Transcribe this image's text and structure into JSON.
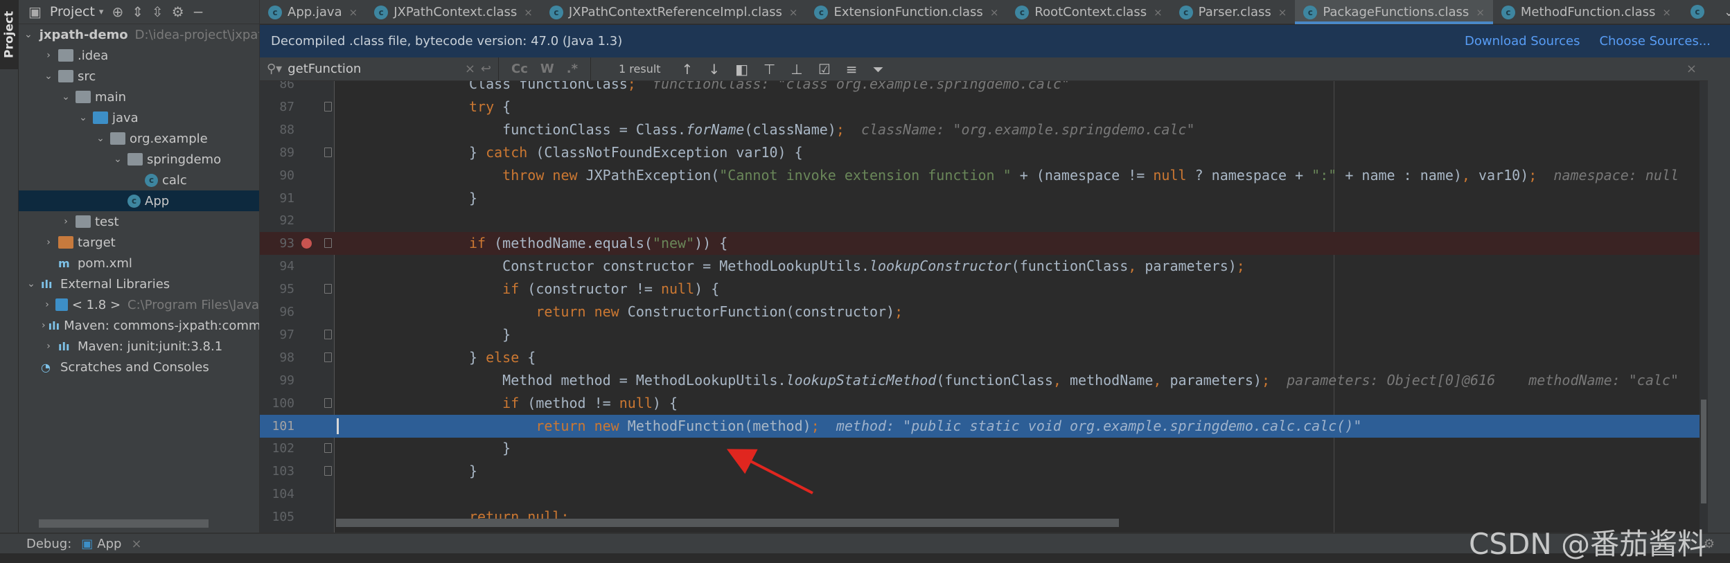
{
  "side_strip": {
    "label": "Project"
  },
  "project_panel": {
    "title": "Project",
    "tree": [
      {
        "label": "jxpath-demo",
        "path": "D:\\idea-project\\jxpath",
        "level": 0,
        "arrow": "down",
        "icon": "module-icon",
        "bold": true
      },
      {
        "label": ".idea",
        "level": 1,
        "arrow": "right",
        "icon": "folder-icon"
      },
      {
        "label": "src",
        "level": 1,
        "arrow": "down",
        "icon": "folder-icon"
      },
      {
        "label": "main",
        "level": 2,
        "arrow": "down",
        "icon": "folder-icon"
      },
      {
        "label": "java",
        "level": 3,
        "arrow": "down",
        "icon": "source-folder-icon"
      },
      {
        "label": "org.example",
        "level": 4,
        "arrow": "down",
        "icon": "package-icon"
      },
      {
        "label": "springdemo",
        "level": 5,
        "arrow": "down",
        "icon": "package-icon"
      },
      {
        "label": "calc",
        "level": 6,
        "arrow": "",
        "icon": "class-icon"
      },
      {
        "label": "App",
        "level": 5,
        "arrow": "",
        "icon": "class-icon",
        "selected": true
      },
      {
        "label": "test",
        "level": 2,
        "arrow": "right",
        "icon": "folder-icon"
      },
      {
        "label": "target",
        "level": 1,
        "arrow": "right",
        "icon": "excluded-folder-icon"
      },
      {
        "label": "pom.xml",
        "level": 1,
        "arrow": "",
        "icon": "maven-icon"
      },
      {
        "label": "External Libraries",
        "level": 0,
        "arrow": "down",
        "icon": "library-icon"
      },
      {
        "label": "< 1.8 >",
        "path": "C:\\Program Files\\Java",
        "level": 1,
        "arrow": "right",
        "icon": "jdk-icon"
      },
      {
        "label": "Maven: commons-jxpath:commons-jxpath",
        "level": 1,
        "arrow": "right",
        "icon": "library-icon"
      },
      {
        "label": "Maven: junit:junit:3.8.1",
        "level": 1,
        "arrow": "right",
        "icon": "library-icon"
      },
      {
        "label": "Scratches and Consoles",
        "level": 0,
        "arrow": "",
        "icon": "scratches-icon"
      }
    ]
  },
  "tabs": [
    {
      "label": "App.java"
    },
    {
      "label": "JXPathContext.class"
    },
    {
      "label": "JXPathContextReferenceImpl.class"
    },
    {
      "label": "ExtensionFunction.class"
    },
    {
      "label": "RootContext.class"
    },
    {
      "label": "Parser.class"
    },
    {
      "label": "PackageFunctions.class",
      "active": true
    },
    {
      "label": "MethodFunction.class"
    }
  ],
  "notification": {
    "text": "Decompiled .class file, bytecode version: 47.0 (Java 1.3)",
    "download_sources": "Download Sources",
    "choose_sources": "Choose Sources..."
  },
  "search": {
    "value": "getFunction",
    "case_label": "Cc",
    "words_label": "W",
    "regex_label": ".*",
    "result": "1 result"
  },
  "code": {
    "lines": [
      {
        "n": "86",
        "indent": 2,
        "tokens": [
          [
            "Class functionClass",
            ""
          ],
          [
            ";",
            "kw"
          ]
        ],
        "hint": "functionClass: \"class org.example.springdemo.calc\""
      },
      {
        "n": "87",
        "indent": 2,
        "fold": true,
        "tokens": [
          [
            "try",
            "kw"
          ],
          [
            " {",
            ""
          ]
        ]
      },
      {
        "n": "88",
        "indent": 3,
        "tokens": [
          [
            "functionClass = Class.",
            ""
          ],
          [
            "forName",
            "it"
          ],
          [
            "(className)",
            ""
          ],
          [
            ";",
            "kw"
          ]
        ],
        "hint": "className: \"org.example.springdemo.calc\""
      },
      {
        "n": "89",
        "indent": 2,
        "fold": true,
        "tokens": [
          [
            "} ",
            ""
          ],
          [
            "catch",
            "kw"
          ],
          [
            " (ClassNotFoundException var10) {",
            ""
          ]
        ]
      },
      {
        "n": "90",
        "indent": 3,
        "tokens": [
          [
            "throw new",
            "kw"
          ],
          [
            " JXPathException(",
            ""
          ],
          [
            "\"Cannot invoke extension function \"",
            "str"
          ],
          [
            " + (namespace != ",
            ""
          ],
          [
            "null",
            "kw"
          ],
          [
            " ? namespace + ",
            ""
          ],
          [
            "\":\"",
            "str"
          ],
          [
            " + name : name)",
            ""
          ],
          [
            ",",
            "kw"
          ],
          [
            " var10)",
            ""
          ],
          [
            ";",
            "kw"
          ]
        ],
        "hint": "namespace: null    n"
      },
      {
        "n": "91",
        "indent": 2,
        "tokens": [
          [
            "}",
            ""
          ]
        ]
      },
      {
        "n": "92",
        "indent": 0,
        "tokens": []
      },
      {
        "n": "93",
        "indent": 2,
        "fold": true,
        "breakpoint": true,
        "tokens": [
          [
            "if",
            "kw"
          ],
          [
            " (methodName.equals(",
            ""
          ],
          [
            "\"new\"",
            "str"
          ],
          [
            ")) {",
            ""
          ]
        ]
      },
      {
        "n": "94",
        "indent": 3,
        "tokens": [
          [
            "Constructor constructor = MethodLookupUtils.",
            ""
          ],
          [
            "lookupConstructor",
            "it"
          ],
          [
            "(functionClass",
            ""
          ],
          [
            ",",
            "kw"
          ],
          [
            " parameters)",
            ""
          ],
          [
            ";",
            "kw"
          ]
        ]
      },
      {
        "n": "95",
        "indent": 3,
        "fold": true,
        "tokens": [
          [
            "if",
            "kw"
          ],
          [
            " (constructor != ",
            ""
          ],
          [
            "null",
            "kw"
          ],
          [
            ") {",
            ""
          ]
        ]
      },
      {
        "n": "96",
        "indent": 4,
        "tokens": [
          [
            "return new",
            "kw"
          ],
          [
            " ConstructorFunction(constructor)",
            ""
          ],
          [
            ";",
            "kw"
          ]
        ]
      },
      {
        "n": "97",
        "indent": 3,
        "fold": true,
        "tokens": [
          [
            "}",
            ""
          ]
        ]
      },
      {
        "n": "98",
        "indent": 2,
        "fold": true,
        "tokens": [
          [
            "} ",
            ""
          ],
          [
            "else",
            "kw"
          ],
          [
            " {",
            ""
          ]
        ]
      },
      {
        "n": "99",
        "indent": 3,
        "tokens": [
          [
            "Method method = MethodLookupUtils.",
            ""
          ],
          [
            "lookupStaticMethod",
            "it"
          ],
          [
            "(functionClass",
            ""
          ],
          [
            ",",
            "kw"
          ],
          [
            " methodName",
            ""
          ],
          [
            ",",
            "kw"
          ],
          [
            " parameters)",
            ""
          ],
          [
            ";",
            "kw"
          ]
        ],
        "hint": "parameters: Object[0]@616    methodName: \"calc\"    f"
      },
      {
        "n": "100",
        "indent": 3,
        "fold": true,
        "tokens": [
          [
            "if",
            "kw"
          ],
          [
            " (method != ",
            ""
          ],
          [
            "null",
            "kw"
          ],
          [
            ") {",
            ""
          ]
        ]
      },
      {
        "n": "101",
        "indent": 4,
        "exec": true,
        "tokens": [
          [
            "return new",
            "kw"
          ],
          [
            " MethodFunction(method)",
            ""
          ],
          [
            ";",
            "kw"
          ]
        ],
        "hint": "method: \"public static void org.example.springdemo.calc.calc()\""
      },
      {
        "n": "102",
        "indent": 3,
        "fold": true,
        "tokens": [
          [
            "}",
            ""
          ]
        ]
      },
      {
        "n": "103",
        "indent": 2,
        "fold": true,
        "tokens": [
          [
            "}",
            ""
          ]
        ]
      },
      {
        "n": "104",
        "indent": 0,
        "tokens": []
      },
      {
        "n": "105",
        "indent": 2,
        "tokens": [
          [
            "return null;",
            "kw"
          ]
        ]
      }
    ]
  },
  "debug_bar": {
    "label": "Debug:",
    "session": "App"
  },
  "watermark": "CSDN @番茄酱料",
  "colors": {
    "keyword": "#cc7832",
    "string": "#6a8759",
    "hint": "#787878",
    "exec_line": "#2d5e96",
    "breakpoint": "#c75450",
    "accent": "#4a88c7",
    "annotation_arrow": "#e0261f"
  }
}
